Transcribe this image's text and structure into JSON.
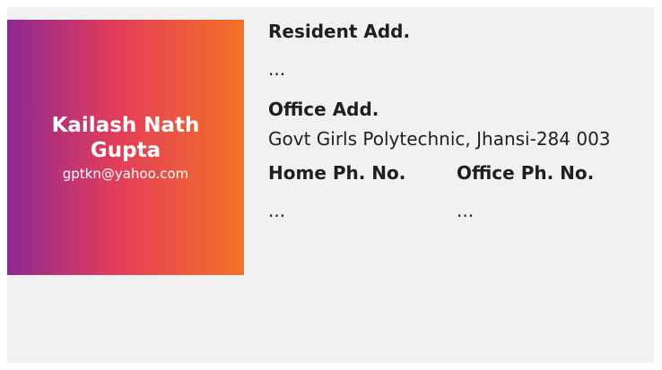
{
  "profile": {
    "name": "Kailash Nath Gupta",
    "email": "gptkn@yahoo.com"
  },
  "details": {
    "resident_label": "Resident Add.",
    "resident_value": "...",
    "office_label": "Office Add.",
    "office_value": "Govt Girls Polytechnic, Jhansi-284 003",
    "home_phone_label": "Home Ph. No.",
    "home_phone_value": "...",
    "office_phone_label": "Office Ph. No.",
    "office_phone_value": "..."
  },
  "colors": {
    "gradient_start": "#8e2a93",
    "gradient_mid": "#e23c5b",
    "gradient_end": "#f47226",
    "card_background": "#f1f1f1"
  }
}
